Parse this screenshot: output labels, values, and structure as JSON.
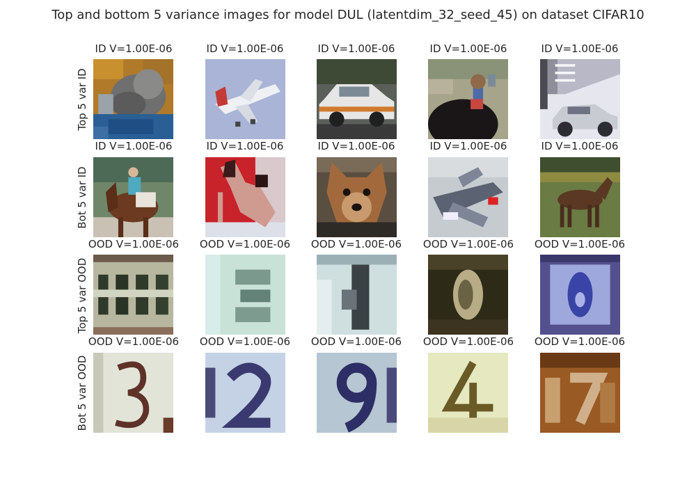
{
  "figure": {
    "title": "Top and bottom 5 variance images for model DUL (latentdim_32_seed_45) on dataset CIFAR10",
    "rows": [
      {
        "label": "Top 5 var ID",
        "cells": [
          {
            "caption": "ID V=1.00E-06",
            "depicts": "cat-image"
          },
          {
            "caption": "ID V=1.00E-06",
            "depicts": "airplane-image"
          },
          {
            "caption": "ID V=1.00E-06",
            "depicts": "car-image"
          },
          {
            "caption": "ID V=1.00E-06",
            "depicts": "bird-image"
          },
          {
            "caption": "ID V=1.00E-06",
            "depicts": "car-image"
          }
        ]
      },
      {
        "label": "Bot 5 var ID",
        "cells": [
          {
            "caption": "ID V=1.00E-06",
            "depicts": "horse-rider-image"
          },
          {
            "caption": "ID V=1.00E-06",
            "depicts": "dog-image"
          },
          {
            "caption": "ID V=1.00E-06",
            "depicts": "dog-image"
          },
          {
            "caption": "ID V=1.00E-06",
            "depicts": "airplane-image"
          },
          {
            "caption": "ID V=1.00E-06",
            "depicts": "horse-image"
          }
        ]
      },
      {
        "label": "Top 5 var OOD",
        "cells": [
          {
            "caption": "OOD V=1.00E-06",
            "depicts": "house-number-image"
          },
          {
            "caption": "OOD V=1.00E-06",
            "depicts": "house-number-image"
          },
          {
            "caption": "OOD V=1.00E-06",
            "depicts": "house-number-image"
          },
          {
            "caption": "OOD V=1.00E-06",
            "depicts": "house-number-image"
          },
          {
            "caption": "OOD V=1.00E-06",
            "depicts": "house-number-image"
          }
        ]
      },
      {
        "label": "Bot 5 var OOD",
        "cells": [
          {
            "caption": "OOD V=1.00E-06",
            "depicts": "house-number-image"
          },
          {
            "caption": "OOD V=1.00E-06",
            "depicts": "house-number-image"
          },
          {
            "caption": "OOD V=1.00E-06",
            "depicts": "house-number-image"
          },
          {
            "caption": "OOD V=1.00E-06",
            "depicts": "house-number-image"
          },
          {
            "caption": "OOD V=1.00E-06",
            "depicts": "house-number-image"
          }
        ]
      }
    ]
  }
}
